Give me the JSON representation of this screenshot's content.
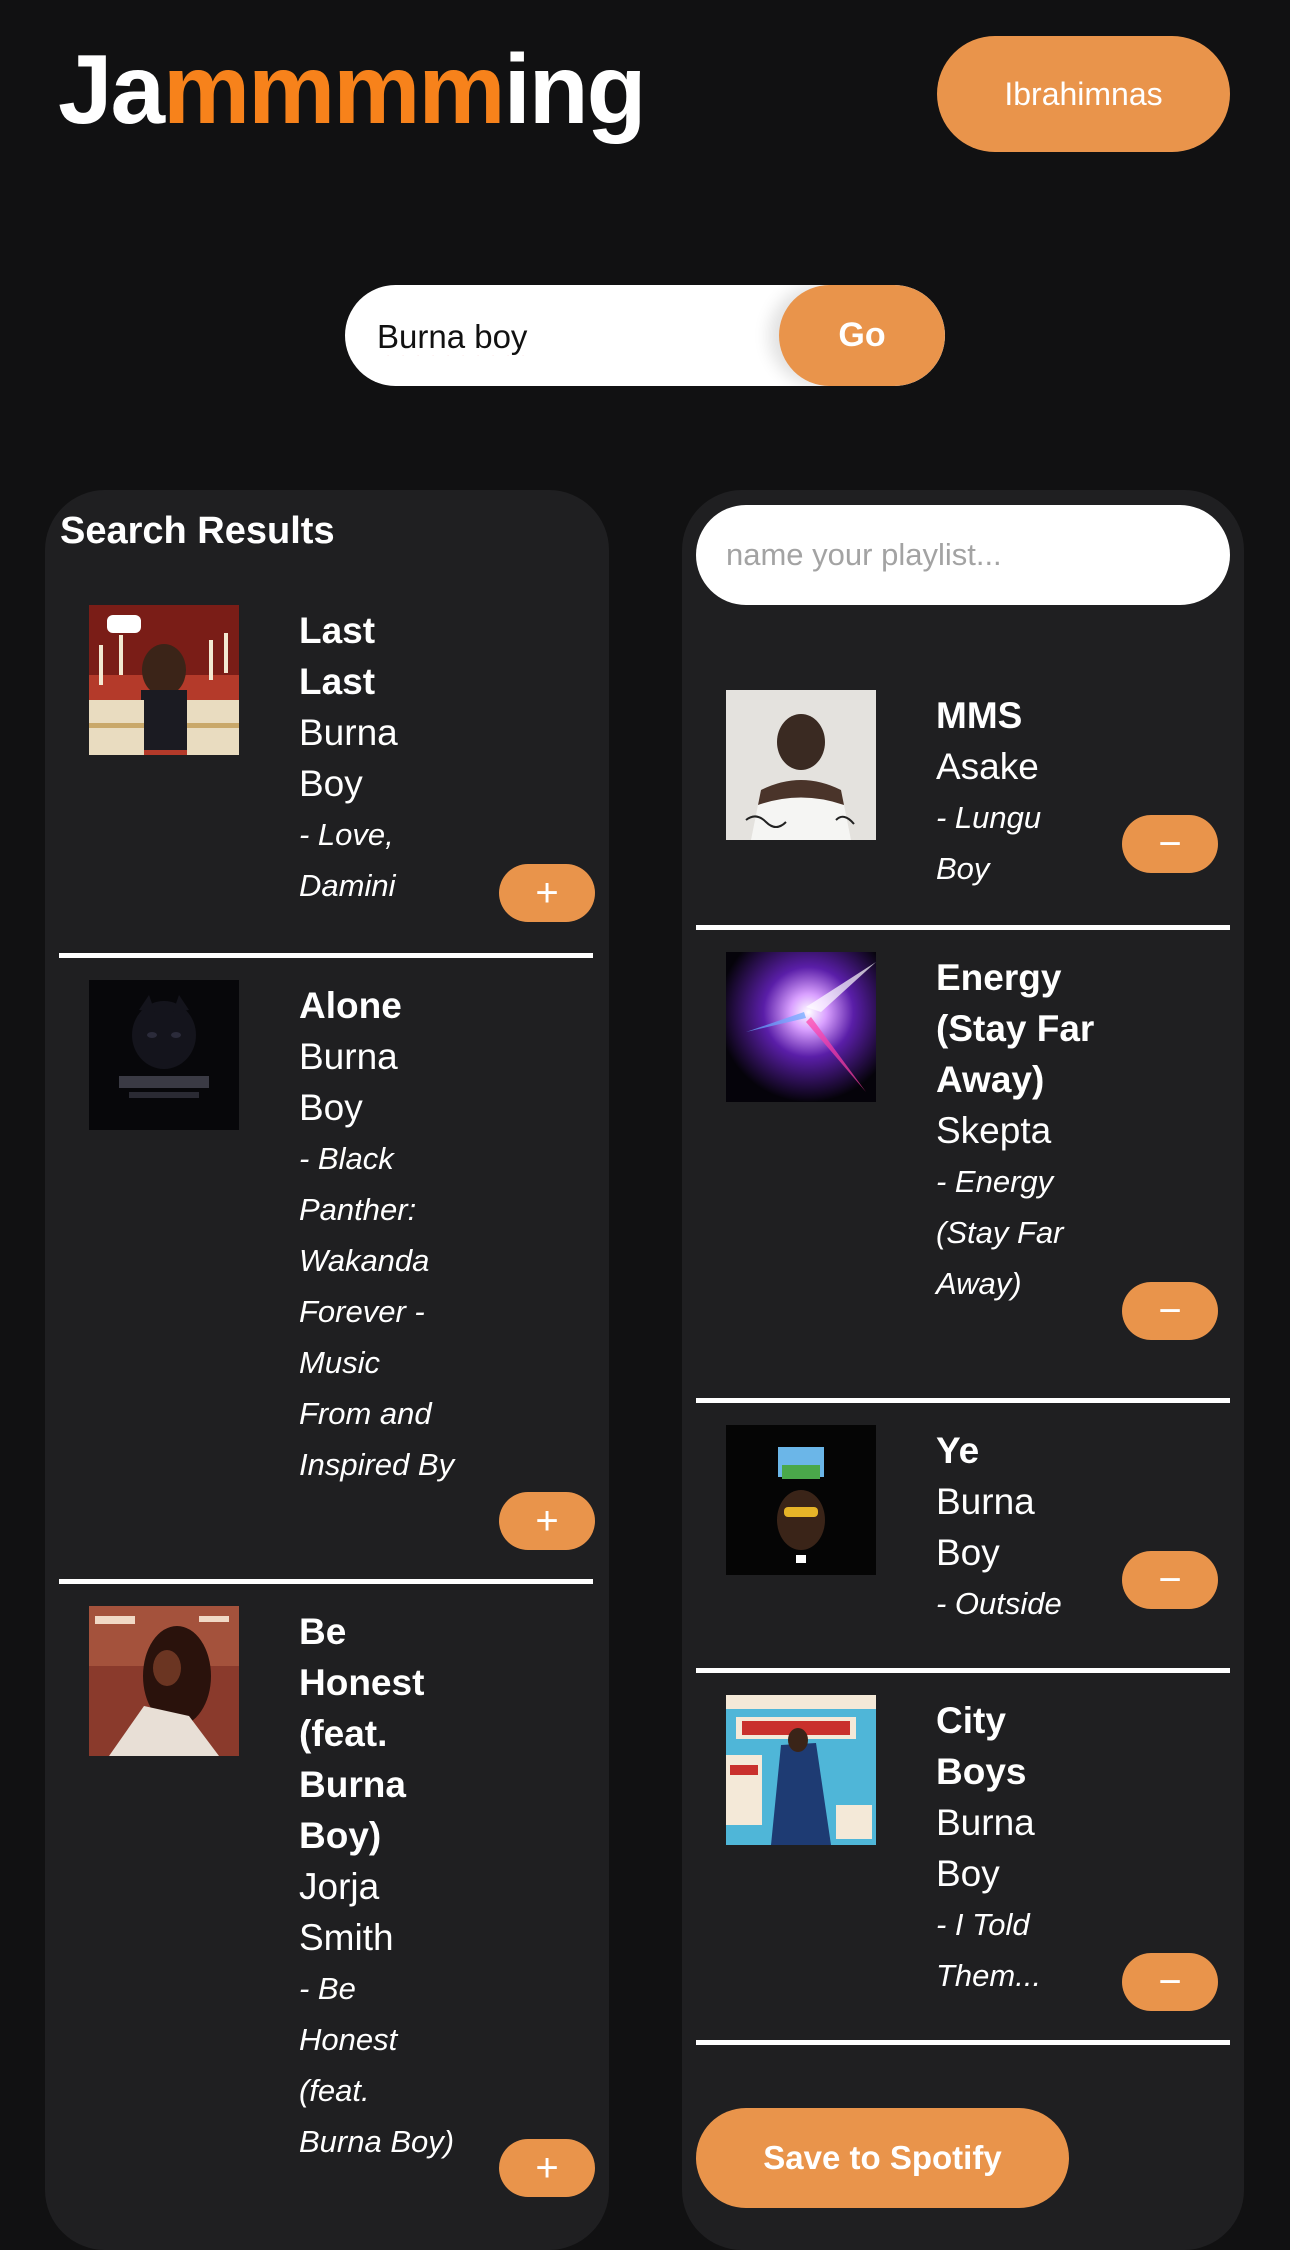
{
  "header": {
    "logo_part1": "Ja",
    "logo_accent": "mmmm",
    "logo_part2": "ing",
    "user_label": "Ibrahimnas"
  },
  "search": {
    "value": "Burna boy",
    "go_label": "Go"
  },
  "results": {
    "title": "Search Results",
    "add_label": "+",
    "tracks": [
      {
        "name": "Last Last",
        "artist": "Burna Boy",
        "album": "- Love, Damini"
      },
      {
        "name": "Alone",
        "artist": "Burna Boy",
        "album": "- Black Panther: Wakanda Forever - Music From and Inspired By"
      },
      {
        "name": "Be Honest (feat. Burna Boy)",
        "artist": "Jorja Smith",
        "album": "- Be Honest (feat. Burna Boy)"
      }
    ]
  },
  "playlist": {
    "placeholder": "name your playlist...",
    "remove_label": "−",
    "save_label": "Save to Spotify",
    "tracks": [
      {
        "name": "MMS",
        "artist": "Asake",
        "album": "- Lungu Boy"
      },
      {
        "name": "Energy (Stay Far Away)",
        "artist": "Skepta",
        "album": "- Energy (Stay Far Away)"
      },
      {
        "name": "Ye",
        "artist": "Burna Boy",
        "album": "- Outside"
      },
      {
        "name": "City Boys",
        "artist": "Burna Boy",
        "album": "- I Told Them..."
      }
    ]
  },
  "colors": {
    "background": "#111112",
    "panel": "#1f1f21",
    "accent": "#e9944b",
    "logo_accent": "#f7821b"
  }
}
